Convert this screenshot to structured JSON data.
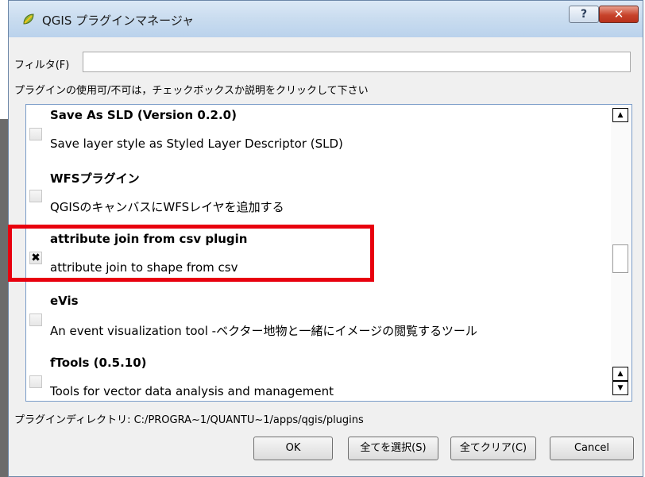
{
  "window": {
    "title": "QGIS プラグインマネージャ",
    "help_button": "?",
    "close_button": "✕"
  },
  "filter": {
    "label": "フィルタ(F)",
    "value": "",
    "placeholder": ""
  },
  "hint": "プラグインの使用可/不可は，チェックボックスか説明をクリックして下さい",
  "plugins": [
    {
      "name": "Save As SLD (Version 0.2.0)",
      "description": "Save layer style as Styled Layer Descriptor (SLD)",
      "checked": false
    },
    {
      "name": "WFSプラグイン",
      "description": "QGISのキャンバスにWFSレイヤを追加する",
      "checked": false
    },
    {
      "name": "attribute join from csv plugin",
      "description": "attribute join to shape from csv",
      "checked": true
    },
    {
      "name": "eVis",
      "description": "An event visualization tool -ベクター地物と一緒にイメージの閲覧するツール",
      "checked": false
    },
    {
      "name": "fTools (0.5.10)",
      "description": "Tools for vector data analysis and management",
      "checked": false
    }
  ],
  "plugin_dir": "プラグインディレクトリ: C:/PROGRA~1/QUANTU~1/apps/qgis/plugins",
  "buttons": {
    "ok": "OK",
    "select_all": "全てを選択(S)",
    "clear_all": "全てクリア(C)",
    "cancel": "Cancel"
  },
  "colors": {
    "highlight": "#e8000e",
    "list_border": "#7a9cc8"
  },
  "icons": {
    "app": "qgis-logo-icon",
    "scroll_up": "arrow-up-icon",
    "scroll_down": "arrow-down-icon"
  }
}
